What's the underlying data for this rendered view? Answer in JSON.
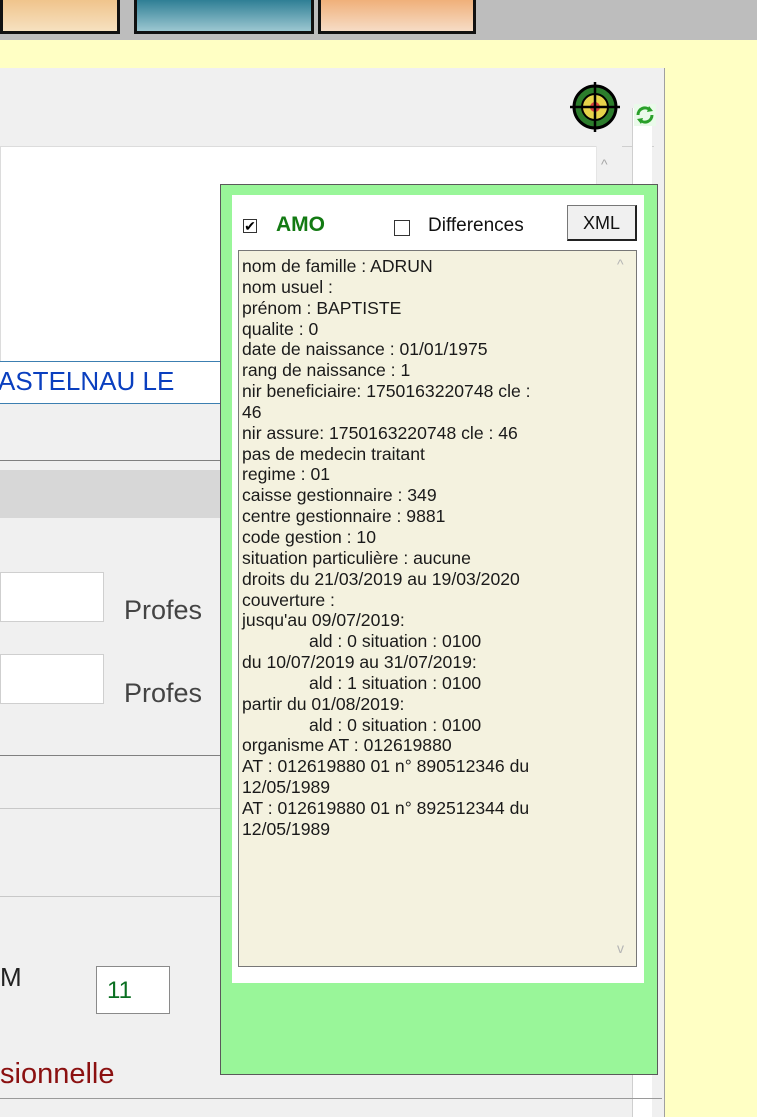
{
  "header": {
    "scroll_up_glyph": "^",
    "refresh_glyph": "↻"
  },
  "form": {
    "city_value": "ASTELNAU LE",
    "profession_label_1": "Profes",
    "profession_label_2": "Profes",
    "m_label": "M",
    "m_value": "11",
    "section_label": "sionnelle"
  },
  "amo_panel": {
    "amo_checked_glyph": "✔",
    "amo_label": "AMO",
    "differences_label": "Differences",
    "xml_button_label": "XML",
    "scroll_up_glyph": "^",
    "scroll_down_glyph": "v",
    "lines": [
      "nom de famille : ADRUN",
      "nom usuel :",
      "prénom : BAPTISTE",
      "qualite : 0",
      "date de naissance : 01/01/1975",
      "rang de naissance : 1",
      "nir beneficiaire: 1750163220748 cle :",
      "46",
      "nir assure: 1750163220748 cle : 46",
      "pas de medecin traitant",
      "regime : 01",
      "caisse gestionnaire : 349",
      "centre gestionnaire : 9881",
      "code gestion : 10",
      "situation particulière : aucune",
      "droits du 21/03/2019 au 19/03/2020",
      "couverture :",
      "jusqu'au 09/07/2019:",
      "ald : 0 situation : 0100",
      "du 10/07/2019 au 31/07/2019:",
      "ald : 1 situation : 0100",
      "partir du 01/08/2019:",
      "ald : 0 situation : 0100",
      "organisme AT : 012619880",
      "AT : 012619880 01 n° 890512346 du",
      "12/05/1989",
      "AT : 012619880 01 n° 892512344 du",
      "12/05/1989"
    ]
  },
  "colors": {
    "popup_bg": "#99f699",
    "info_bg": "#f4f2df",
    "amo_label": "#137a13",
    "city_text": "#0a3fbf",
    "section_label": "#8b1010",
    "yellow_bg": "#ffffc4"
  }
}
